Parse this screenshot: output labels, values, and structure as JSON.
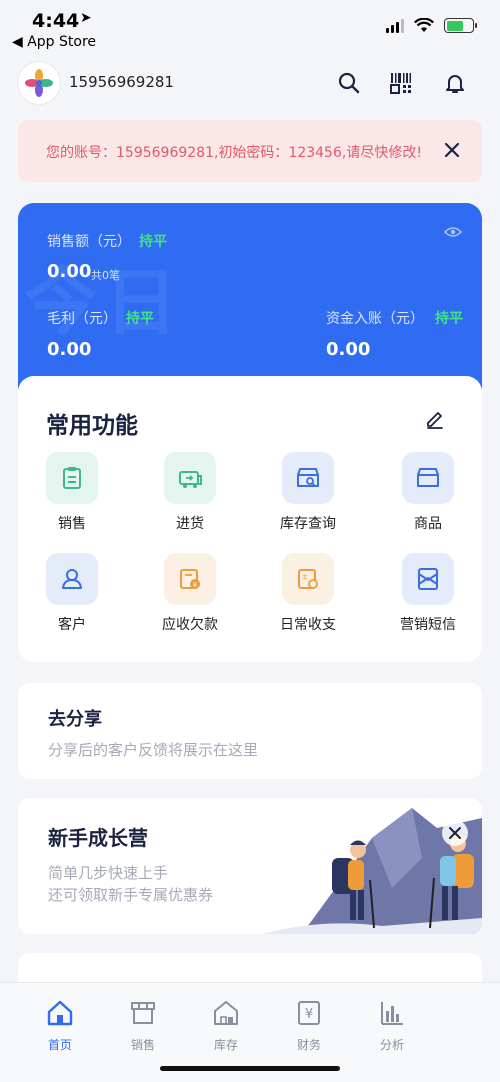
{
  "status_bar": {
    "time": "4:44",
    "back_label": "◀ App Store"
  },
  "header": {
    "account": "15956969281",
    "icons": [
      "search-icon",
      "qrcode-scan-icon",
      "bell-icon"
    ]
  },
  "notice": {
    "text": "您的账号：15956969281,初始密码：123456,请尽快修改!"
  },
  "stats": {
    "sales_label": "销售额（元）",
    "sales_trend": "持平",
    "sales_value": "0.00",
    "sales_count": "共0笔",
    "profit_label": "毛利（元）",
    "profit_trend": "持平",
    "profit_value": "0.00",
    "inflow_label": "资金入账（元）",
    "inflow_trend": "持平",
    "inflow_value": "0.00",
    "watermark": "今日"
  },
  "functions": {
    "title": "常用功能",
    "items": [
      {
        "label": "销售",
        "icon": "sales-icon"
      },
      {
        "label": "进货",
        "icon": "purchase-icon"
      },
      {
        "label": "库存查询",
        "icon": "inventory-search-icon"
      },
      {
        "label": "商品",
        "icon": "product-box-icon"
      },
      {
        "label": "客户",
        "icon": "customer-icon"
      },
      {
        "label": "应收欠款",
        "icon": "receivable-icon"
      },
      {
        "label": "日常收支",
        "icon": "daily-finance-icon"
      },
      {
        "label": "营销短信",
        "icon": "sms-icon"
      }
    ]
  },
  "share": {
    "title": "去分享",
    "subtitle": "分享后的客户反馈将展示在这里"
  },
  "growth": {
    "title": "新手成长营",
    "line1": "简单几步快速上手",
    "line2": "还可领取新手专属优惠券"
  },
  "tabs": [
    {
      "label": "首页",
      "icon": "home-icon",
      "active": true
    },
    {
      "label": "销售",
      "icon": "sales-store-icon",
      "active": false
    },
    {
      "label": "库存",
      "icon": "warehouse-icon",
      "active": false
    },
    {
      "label": "财务",
      "icon": "finance-icon",
      "active": false
    },
    {
      "label": "分析",
      "icon": "chart-icon",
      "active": false
    }
  ],
  "colors": {
    "primary": "#2f6cf2",
    "trend": "#43e08b",
    "notice_bg": "#fbe6e8",
    "notice_text": "#e05a6a"
  }
}
